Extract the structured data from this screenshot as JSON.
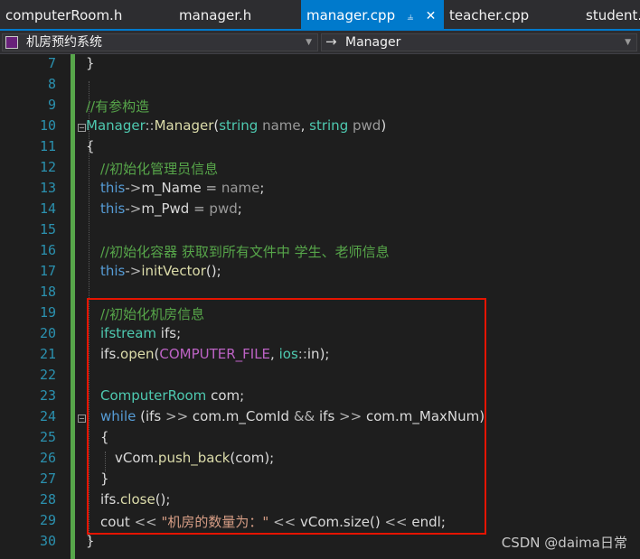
{
  "tabs": [
    {
      "label": "computerRoom.h"
    },
    {
      "label": "manager.h"
    },
    {
      "label": "manager.cpp",
      "active": true
    },
    {
      "label": "teacher.cpp"
    },
    {
      "label": "student."
    }
  ],
  "tab_pin_icon": "pin-icon",
  "tab_close_icon": "close-icon",
  "nav": {
    "project": "机房预约系统",
    "member": "Manager"
  },
  "colors": {
    "accent": "#007acc",
    "comment": "#57a64a",
    "keyword": "#569cd6",
    "type": "#4ec9b0",
    "highlight_box": "#e51400"
  },
  "lines": [
    {
      "n": "7"
    },
    {
      "n": "8"
    },
    {
      "n": "9"
    },
    {
      "n": "10"
    },
    {
      "n": "11"
    },
    {
      "n": "12"
    },
    {
      "n": "13"
    },
    {
      "n": "14"
    },
    {
      "n": "15"
    },
    {
      "n": "16"
    },
    {
      "n": "17"
    },
    {
      "n": "18"
    },
    {
      "n": "19"
    },
    {
      "n": "20"
    },
    {
      "n": "21"
    },
    {
      "n": "22"
    },
    {
      "n": "23"
    },
    {
      "n": "24"
    },
    {
      "n": "25"
    },
    {
      "n": "26"
    },
    {
      "n": "27"
    },
    {
      "n": "28"
    },
    {
      "n": "29"
    },
    {
      "n": "30"
    }
  ],
  "code": {
    "l7": "}",
    "l9_comment": "//有参构造",
    "l10_class": "Manager",
    "l10_scope": "::",
    "l10_fn": "Manager",
    "l10_open": "(",
    "l10_t1": "string",
    "l10_p1": "name",
    "l10_comma": ", ",
    "l10_t2": "string",
    "l10_p2": "pwd",
    "l10_close": ")",
    "l11": "{",
    "l12_comment": "//初始化管理员信息",
    "l13_this": "this",
    "l13_arrow": "->",
    "l13_member": "m_Name",
    "l13_eq": " = ",
    "l13_val": "name",
    "l13_semi": ";",
    "l14_this": "this",
    "l14_arrow": "->",
    "l14_member": "m_Pwd",
    "l14_eq": " = ",
    "l14_val": "pwd",
    "l14_semi": ";",
    "l16_comment": "//初始化容器 获取到所有文件中 学生、老师信息",
    "l17_this": "this",
    "l17_arrow": "->",
    "l17_fn": "initVector",
    "l17_rest": "();",
    "l19_comment": "//初始化机房信息",
    "l20_type": "ifstream",
    "l20_var": "ifs",
    "l20_semi": ";",
    "l21_var": "ifs",
    "l21_dot": ".",
    "l21_fn": "open",
    "l21_open": "(",
    "l21_macro": "COMPUTER_FILE",
    "l21_comma": ", ",
    "l21_ns": "ios",
    "l21_scope": "::",
    "l21_in": "in",
    "l21_close": ");",
    "l23_type": "ComputerRoom",
    "l23_var": "com",
    "l23_semi": ";",
    "l24_kw": "while",
    "l24_open": " (",
    "l24_v1": "ifs",
    "l24_op1": " >> ",
    "l24_v2": "com",
    "l24_m1": ".m_ComId",
    "l24_and": " && ",
    "l24_v3": "ifs",
    "l24_op2": " >> ",
    "l24_v4": "com",
    "l24_m2": ".m_MaxNum",
    "l24_close": ")",
    "l25": "{",
    "l26_var": "vCom",
    "l26_dot": ".",
    "l26_fn": "push_back",
    "l26_open": "(",
    "l26_arg": "com",
    "l26_close": ");",
    "l27": "}",
    "l28_var": "ifs",
    "l28_dot": ".",
    "l28_fn": "close",
    "l28_rest": "();",
    "l29_cout": "cout",
    "l29_op1": " << ",
    "l29_str": "\"机房的数量为：\"",
    "l29_op2": " << ",
    "l29_vec": "vCom.size()",
    "l29_op3": " << ",
    "l29_endl": "endl",
    "l29_semi": ";",
    "l30": "}"
  },
  "watermark": "CSDN @daima日常"
}
